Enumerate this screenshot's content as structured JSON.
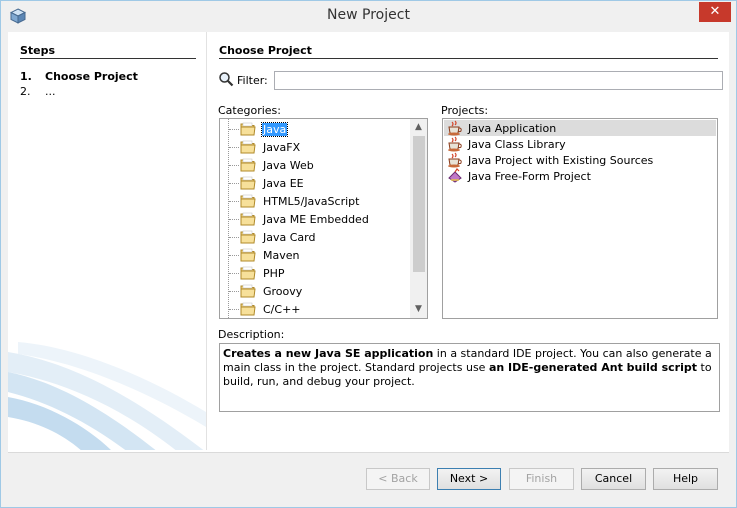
{
  "window": {
    "title": "New Project"
  },
  "steps": {
    "title": "Steps",
    "items": [
      {
        "num": "1.",
        "label": "Choose Project",
        "bold": true
      },
      {
        "num": "2.",
        "label": "...",
        "bold": false
      }
    ]
  },
  "main": {
    "title": "Choose Project",
    "filter": {
      "label": "Filter:",
      "value": ""
    },
    "categories_label": "Categories:",
    "projects_label": "Projects:",
    "categories": [
      "Java",
      "JavaFX",
      "Java Web",
      "Java EE",
      "HTML5/JavaScript",
      "Java ME Embedded",
      "Java Card",
      "Maven",
      "PHP",
      "Groovy",
      "C/C++"
    ],
    "selected_category": "Java",
    "projects": [
      "Java Application",
      "Java Class Library",
      "Java Project with Existing Sources",
      "Java Free-Form Project"
    ],
    "selected_project": "Java Application",
    "description_label": "Description:",
    "description": {
      "p1_bold": "Creates a new Java SE application",
      "p1_rest": " in a standard IDE project. You can also generate a main class in the project. Standard projects use ",
      "p2_bold": "an IDE-generated Ant build script",
      "p2_rest": " to build, run, and debug your project."
    }
  },
  "buttons": {
    "back": "< Back",
    "next": "Next >",
    "finish": "Finish",
    "cancel": "Cancel",
    "help": "Help"
  },
  "icons": {
    "app": "netbeans-cube-icon",
    "close": "close-x-icon",
    "filter": "magnifier-icon",
    "folder": "folder-icon",
    "project": "java-coffee-cup-icon",
    "freeform": "freeform-project-icon"
  }
}
